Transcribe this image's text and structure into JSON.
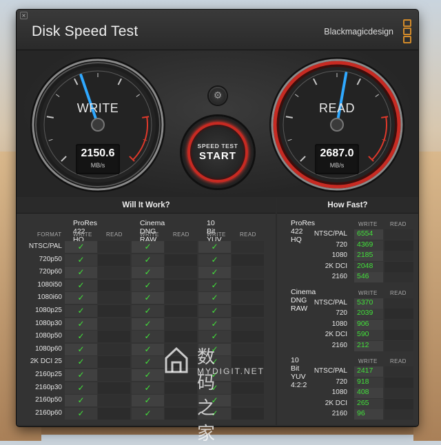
{
  "app": {
    "title": "Disk Speed Test",
    "brand": "Blackmagicdesign"
  },
  "gauges": {
    "write": {
      "label": "WRITE",
      "value": "2150.6",
      "unit": "MB/s",
      "needle_value": 2150.6
    },
    "read": {
      "label": "READ",
      "value": "2687.0",
      "unit": "MB/s",
      "needle_value": 2687.0
    },
    "start": {
      "line1": "SPEED TEST",
      "line2": "START"
    }
  },
  "will_it_work": {
    "header": "Will It Work?",
    "format_label": "FORMAT",
    "columns": [
      {
        "name": "ProRes 422 HQ",
        "write": "WRITE",
        "read": "READ"
      },
      {
        "name": "Cinema DNG RAW",
        "write": "WRITE",
        "read": "READ"
      },
      {
        "name": "10 Bit YUV 4:2:2",
        "write": "WRITE",
        "read": "READ"
      }
    ],
    "check": "✓",
    "rows": [
      "NTSC/PAL",
      "720p50",
      "720p60",
      "1080i50",
      "1080i60",
      "1080p25",
      "1080p30",
      "1080p50",
      "1080p60",
      "2K DCI 25",
      "2160p25",
      "2160p30",
      "2160p50",
      "2160p60"
    ]
  },
  "how_fast": {
    "header": "How Fast?",
    "groups": [
      {
        "name": "ProRes 422 HQ",
        "write": "WRITE",
        "read": "READ",
        "rows": [
          {
            "label": "NTSC/PAL",
            "value": "6554"
          },
          {
            "label": "720",
            "value": "4369"
          },
          {
            "label": "1080",
            "value": "2185"
          },
          {
            "label": "2K DCI",
            "value": "2048"
          },
          {
            "label": "2160",
            "value": "546"
          }
        ]
      },
      {
        "name": "Cinema DNG RAW",
        "write": "WRITE",
        "read": "READ",
        "rows": [
          {
            "label": "NTSC/PAL",
            "value": "5370"
          },
          {
            "label": "720",
            "value": "2039"
          },
          {
            "label": "1080",
            "value": "906"
          },
          {
            "label": "2K DCI",
            "value": "590"
          },
          {
            "label": "2160",
            "value": "212"
          }
        ]
      },
      {
        "name": "10 Bit YUV 4:2:2",
        "write": "WRITE",
        "read": "READ",
        "rows": [
          {
            "label": "NTSC/PAL",
            "value": "2417"
          },
          {
            "label": "720",
            "value": "918"
          },
          {
            "label": "1080",
            "value": "408"
          },
          {
            "label": "2K DCI",
            "value": "265"
          },
          {
            "label": "2160",
            "value": "96"
          }
        ]
      }
    ]
  },
  "watermark": {
    "big": "数码之家",
    "small": "MYDIGIT.NET"
  },
  "colors": {
    "accent_green": "#42e23a",
    "needle_blue": "#2fa8ff",
    "red_ring": "#c72a22"
  }
}
